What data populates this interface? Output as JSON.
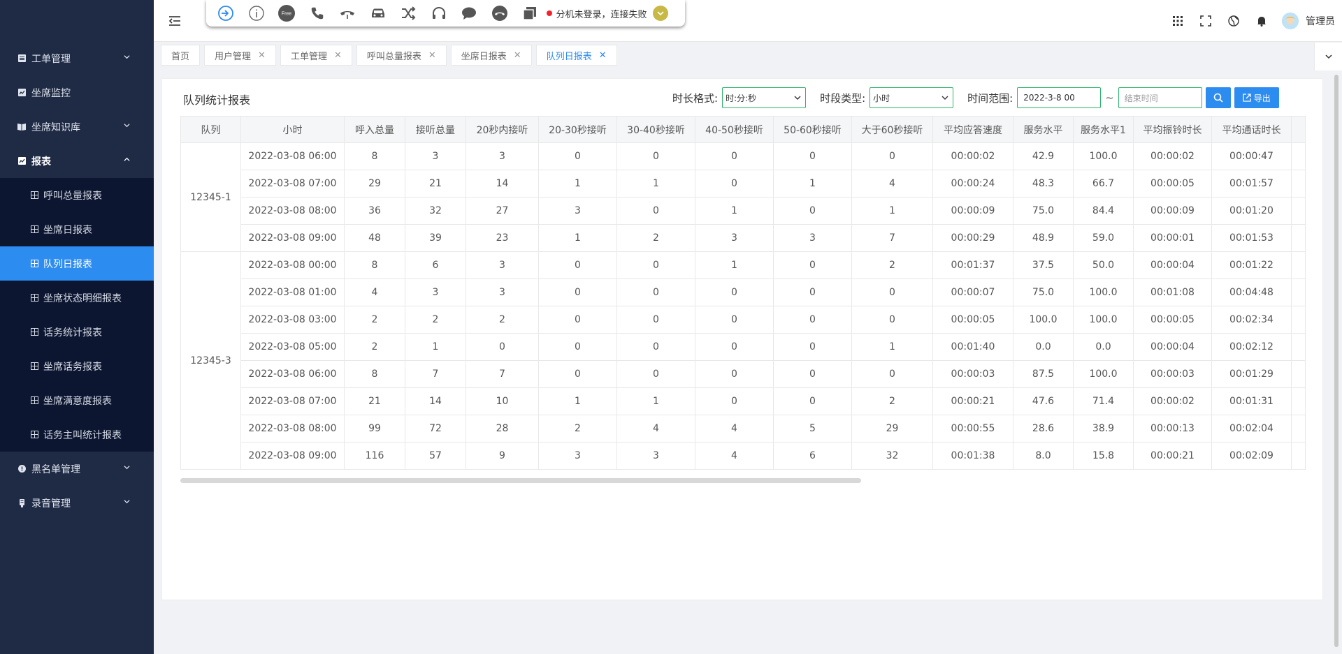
{
  "sidebar": {
    "menu": [
      {
        "label": "工单管理",
        "icon": "list-icon",
        "expanded": false
      },
      {
        "label": "坐席监控",
        "icon": "monitor-icon"
      },
      {
        "label": "坐席知识库",
        "icon": "book-icon",
        "expanded": false
      },
      {
        "label": "报表",
        "icon": "chart-icon",
        "expanded": true
      }
    ],
    "report_items": [
      {
        "label": "呼叫总量报表"
      },
      {
        "label": "坐席日报表"
      },
      {
        "label": "队列日报表"
      },
      {
        "label": "坐席状态明细报表"
      },
      {
        "label": "话务统计报表"
      },
      {
        "label": "坐席话务报表"
      },
      {
        "label": "坐席满意度报表"
      },
      {
        "label": "话务主叫统计报表"
      }
    ],
    "bottom_menu": [
      {
        "label": "黑名单管理",
        "icon": "info-icon"
      },
      {
        "label": "录音管理",
        "icon": "recording-icon"
      }
    ]
  },
  "header": {
    "phone_bar": {
      "free_label": "Free",
      "status_text": "分机未登录，连接失败",
      "status_color": "#f5222d"
    },
    "user_name": "管理员"
  },
  "tabs": [
    {
      "label": "首页",
      "closable": false
    },
    {
      "label": "用户管理",
      "closable": true
    },
    {
      "label": "工单管理",
      "closable": true
    },
    {
      "label": "呼叫总量报表",
      "closable": true
    },
    {
      "label": "坐席日报表",
      "closable": true
    },
    {
      "label": "队列日报表",
      "closable": true,
      "active": true
    }
  ],
  "tab_close_glyph": "✕",
  "report": {
    "title": "队列统计报表",
    "duration_format_label": "时长格式:",
    "duration_format_value": "时:分:秒",
    "period_type_label": "时段类型:",
    "period_type_value": "小时",
    "time_range_label": "时间范围:",
    "start_time": "2022-3-8 00",
    "end_time_placeholder": "结束时间",
    "range_separator": "~",
    "export_label": "导出",
    "columns": [
      "队列",
      "小时",
      "呼入总量",
      "接听总量",
      "20秒内接听",
      "20-30秒接听",
      "30-40秒接听",
      "40-50秒接听",
      "50-60秒接听",
      "大于60秒接听",
      "平均应答速度",
      "服务水平",
      "服务水平1",
      "平均振铃时长",
      "平均通话时长"
    ],
    "groups": [
      {
        "queue": "12345-1",
        "rows": [
          [
            "2022-03-08 06:00",
            "8",
            "3",
            "3",
            "0",
            "0",
            "0",
            "0",
            "0",
            "00:00:02",
            "42.9",
            "100.0",
            "00:00:02",
            "00:00:47"
          ],
          [
            "2022-03-08 07:00",
            "29",
            "21",
            "14",
            "1",
            "1",
            "0",
            "1",
            "4",
            "00:00:24",
            "48.3",
            "66.7",
            "00:00:05",
            "00:01:57"
          ],
          [
            "2022-03-08 08:00",
            "36",
            "32",
            "27",
            "3",
            "0",
            "1",
            "0",
            "1",
            "00:00:09",
            "75.0",
            "84.4",
            "00:00:09",
            "00:01:20"
          ],
          [
            "2022-03-08 09:00",
            "48",
            "39",
            "23",
            "1",
            "2",
            "3",
            "3",
            "7",
            "00:00:29",
            "48.9",
            "59.0",
            "00:00:01",
            "00:01:53"
          ]
        ]
      },
      {
        "queue": "12345-3",
        "rows": [
          [
            "2022-03-08 00:00",
            "8",
            "6",
            "3",
            "0",
            "0",
            "1",
            "0",
            "2",
            "00:01:37",
            "37.5",
            "50.0",
            "00:00:04",
            "00:01:22"
          ],
          [
            "2022-03-08 01:00",
            "4",
            "3",
            "3",
            "0",
            "0",
            "0",
            "0",
            "0",
            "00:00:07",
            "75.0",
            "100.0",
            "00:01:08",
            "00:04:48"
          ],
          [
            "2022-03-08 03:00",
            "2",
            "2",
            "2",
            "0",
            "0",
            "0",
            "0",
            "0",
            "00:00:05",
            "100.0",
            "100.0",
            "00:00:05",
            "00:02:34"
          ],
          [
            "2022-03-08 05:00",
            "2",
            "1",
            "0",
            "0",
            "0",
            "0",
            "0",
            "1",
            "00:01:40",
            "0.0",
            "0.0",
            "00:00:04",
            "00:02:12"
          ],
          [
            "2022-03-08 06:00",
            "8",
            "7",
            "7",
            "0",
            "0",
            "0",
            "0",
            "0",
            "00:00:03",
            "87.5",
            "100.0",
            "00:00:03",
            "00:01:29"
          ],
          [
            "2022-03-08 07:00",
            "21",
            "14",
            "10",
            "1",
            "1",
            "0",
            "0",
            "2",
            "00:00:21",
            "47.6",
            "71.4",
            "00:00:02",
            "00:01:31"
          ],
          [
            "2022-03-08 08:00",
            "99",
            "72",
            "28",
            "2",
            "4",
            "4",
            "5",
            "29",
            "00:00:55",
            "28.6",
            "38.9",
            "00:00:13",
            "00:02:04"
          ],
          [
            "2022-03-08 09:00",
            "116",
            "57",
            "9",
            "3",
            "3",
            "4",
            "6",
            "32",
            "00:01:38",
            "8.0",
            "15.8",
            "00:00:21",
            "00:02:09"
          ]
        ]
      }
    ]
  },
  "colors": {
    "sidebar_bg": "#1f2a44",
    "submenu_bg": "#0c1630",
    "accent": "#2d8cf0",
    "input_border": "#2fb36a"
  }
}
